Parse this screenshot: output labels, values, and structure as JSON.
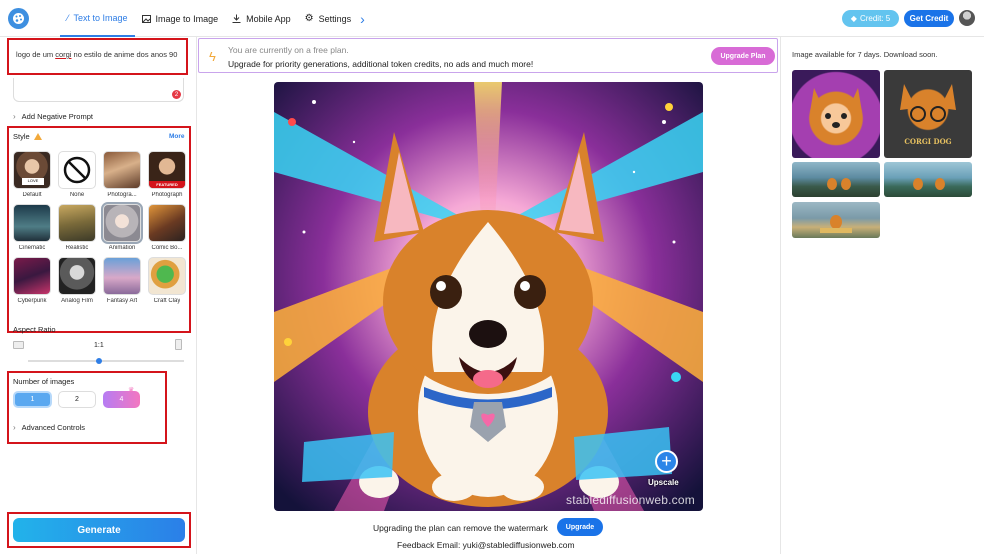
{
  "topbar": {
    "tabs": [
      {
        "label": "Text to Image",
        "icon": "wand-icon",
        "active": true
      },
      {
        "label": "Image to Image",
        "icon": "image-icon",
        "active": false
      },
      {
        "label": "Mobile App",
        "icon": "download-icon",
        "active": false
      },
      {
        "label": "Settings",
        "icon": "gear-icon",
        "active": false
      }
    ],
    "credit_label": "Credit: 5",
    "get_credit_label": "Get Credit"
  },
  "prompt": {
    "text_before": "logo de um ",
    "text_underlined": "corgi",
    "text_after": " no estilo de anime dos anos 90",
    "badge": "2"
  },
  "add_negative_prompt": "Add Negative Prompt",
  "style": {
    "label": "Style",
    "more": "More",
    "items": [
      {
        "label": "Default"
      },
      {
        "label": "None"
      },
      {
        "label": "Photogra..."
      },
      {
        "label": "Photograph",
        "featured": "FEATURED"
      },
      {
        "label": "Cinematic"
      },
      {
        "label": "Realistic"
      },
      {
        "label": "Animation",
        "selected": true
      },
      {
        "label": "Comic Bo..."
      },
      {
        "label": "Cyberpunk"
      },
      {
        "label": "Analog Film"
      },
      {
        "label": "Fantasy Art"
      },
      {
        "label": "Craft Clay"
      }
    ]
  },
  "aspect": {
    "label": "Aspect Ratio",
    "value": "1:1"
  },
  "num_images": {
    "label": "Number of images",
    "options": [
      "1",
      "2",
      "4"
    ],
    "selected": "1"
  },
  "advanced_controls": "Advanced Controls",
  "generate_label": "Generate",
  "banner": {
    "line1": "You are currently on a free plan.",
    "line2": "Upgrade for priority generations, additional token credits, no ads and much more!",
    "button": "Upgrade Plan"
  },
  "main": {
    "upscale_label": "Upscale",
    "watermark": "stablediffusionweb.com",
    "watermark_note": "Upgrading the plan can remove the watermark",
    "upgrade_label": "Upgrade",
    "feedback": "Feedback Email: yuki@stablediffusionweb.com"
  },
  "right_panel": {
    "note": "Image available for 7 days. Download soon.",
    "thumb_caption": "CORGI DOG"
  },
  "colors": {
    "accent": "#2f7ee6",
    "highlight_box": "#d4141b",
    "generate_gradient_start": "#22b3ea",
    "generate_gradient_end": "#2b7fe8",
    "upgrade_plan": "#d86bd6"
  }
}
